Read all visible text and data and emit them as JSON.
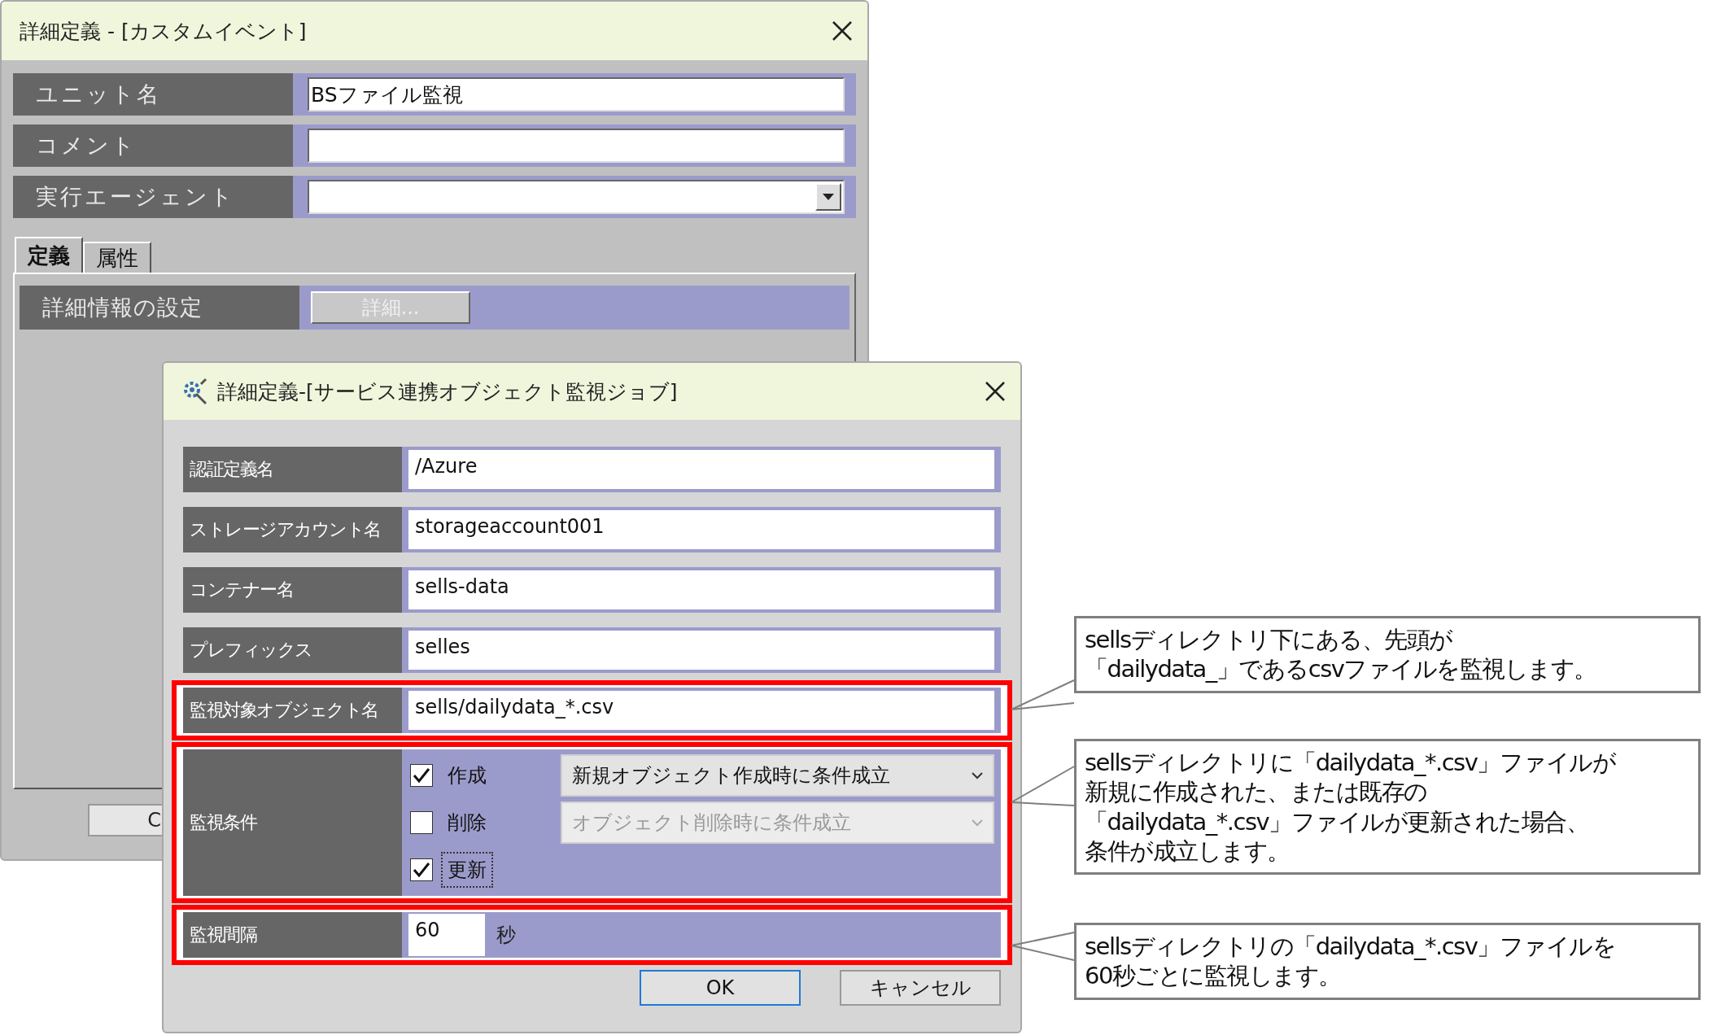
{
  "back_dialog": {
    "title": "詳細定義 - [カスタムイベント]",
    "fields": [
      {
        "kind": "text",
        "label": "ユニット名",
        "value": "BSファイル監視"
      },
      {
        "kind": "text",
        "label": "コメント"
      },
      {
        "kind": "dropdown",
        "label": "実行エージェント"
      }
    ],
    "tabs": [
      {
        "label": "定義",
        "selected": true
      },
      {
        "label": "属性",
        "selected": false
      }
    ],
    "detail_row": {
      "label": "詳細情報の設定",
      "button": "詳細...",
      "disabled": true
    },
    "bottom_button": "C"
  },
  "front_dialog": {
    "title": "詳細定義-[サービス連携オブジェクト監視ジョブ]",
    "rows": [
      {
        "kind": "text",
        "label": "認証定義名",
        "value": "/Azure",
        "highlighted": false
      },
      {
        "kind": "text",
        "label": "ストレージアカウント名",
        "value": "storageaccount001",
        "highlighted": false
      },
      {
        "kind": "text",
        "label": "コンテナー名",
        "value": "sells-data",
        "highlighted": false
      },
      {
        "kind": "text",
        "label": "プレフィックス",
        "value": "selles",
        "highlighted": false
      },
      {
        "kind": "text",
        "label": "監視対象オブジェクト名",
        "value": "sells/dailydata_*.csv",
        "highlighted": true
      },
      {
        "kind": "conditions",
        "label": "監視条件",
        "highlighted": true,
        "options": [
          {
            "label": "作成",
            "checked": true,
            "focused": false,
            "select": {
              "value": "新規オブジェクト作成時に条件成立",
              "disabled": false
            }
          },
          {
            "label": "削除",
            "checked": false,
            "focused": false,
            "select": {
              "value": "オブジェクト削除時に条件成立",
              "disabled": true
            }
          },
          {
            "label": "更新",
            "checked": true,
            "focused": true
          }
        ]
      },
      {
        "kind": "interval",
        "label": "監視間隔",
        "value": "60",
        "unit": "秒",
        "highlighted": true
      }
    ],
    "buttons": [
      {
        "label": "OK",
        "default": true
      },
      {
        "label": "キャンセル",
        "default": false
      }
    ]
  },
  "callouts": [
    {
      "lines": [
        "sellsディレクトリ下にある、先頭が",
        "「dailydata_」であるcsvファイルを監視します。"
      ]
    },
    {
      "lines": [
        "sellsディレクトリに「dailydata_*.csv」ファイルが",
        "新規に作成された、または既存の",
        "「dailydata_*.csv」ファイルが更新された場合、",
        "条件が成立します。"
      ]
    },
    {
      "lines": [
        "sellsディレクトリの「dailydata_*.csv」ファイルを",
        "60秒ごとに監視します。"
      ]
    }
  ]
}
